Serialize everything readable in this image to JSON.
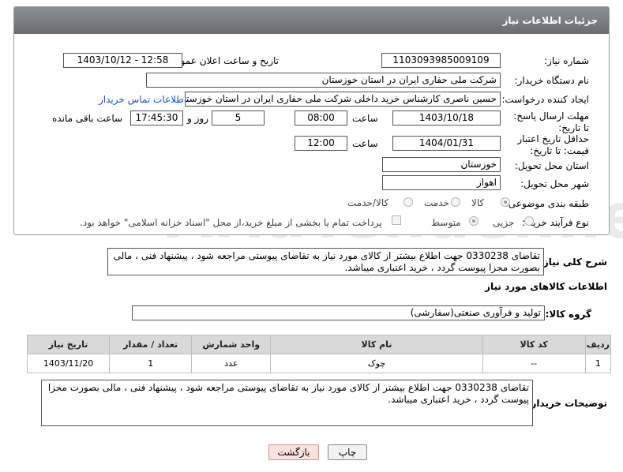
{
  "header": {
    "title": "جزئیات اطلاعات نیاز"
  },
  "fields": {
    "need_number_label": "شماره نیاز:",
    "need_number": "1103093985009109",
    "announce_label": "تاریخ و ساعت اعلان عمومی:",
    "announce_value": "1403/10/12 - 12:58",
    "buyer_org_label": "نام دستگاه خریدار:",
    "buyer_org": "شرکت ملی حفاری ایران در استان خوزستان",
    "requester_label": "ایجاد کننده درخواست:",
    "requester": "حسین ناصری کارشناس خرید داخلی شرکت ملی حفاری ایران در استان خوزستان",
    "contact_link": "اطلاعات تماس خریدار",
    "reply_deadline_label": "مهلت ارسال پاسخ: تا تاریخ:",
    "reply_date": "1403/10/18",
    "time_label": "ساعت",
    "reply_time": "08:00",
    "days_value": "5",
    "days_label": "روز و",
    "remaining_time": "17:45:30",
    "remaining_label": "ساعت باقی مانده",
    "price_validity_label": "حداقل تاریخ اعتبار قیمت: تا تاریخ:",
    "price_date": "1404/01/31",
    "price_time": "12:00",
    "province_label": "استان محل تحویل:",
    "province": "خوزستان",
    "city_label": "شهر محل تحویل:",
    "city": "اهواز",
    "category_label": "طبقه بندی موضوعی:",
    "cat_goods": "کالا",
    "cat_service": "خدمت",
    "cat_goods_service": "کالا/خدمت",
    "process_label": "نوع فرآیند خرید :",
    "proc_small": "جزیی",
    "proc_medium": "متوسط",
    "payment_note": "پرداخت تمام یا بخشی از مبلغ خرید،از محل \"اسناد خزانه اسلامی\" خواهد بود."
  },
  "description": {
    "label": "شرح کلی نیاز:",
    "text": "تقاضای 0330238 جهت اطلاع بیشتر از کالای مورد نیاز به تقاضای پیوستی مراجعه شود ، پیشنهاد فنی ، مالی بصورت مجزا پیوست گردد ، خرید اعتباری میباشد."
  },
  "goods": {
    "section_title": "اطلاعات کالاهای مورد نیاز",
    "group_label": "گروه کالا:",
    "group_value": "تولید و فرآوری صنعتی(سفارشی)",
    "columns": [
      "ردیف",
      "کد کالا",
      "نام کالا",
      "واحد شمارش",
      "تعداد / مقدار",
      "تاریخ نیاز"
    ],
    "rows": [
      [
        "1",
        "--",
        "چوک",
        "عدد",
        "1",
        "1403/11/20"
      ]
    ]
  },
  "buyer_notes": {
    "label": "توضیحات خریدار:",
    "text": "تقاضای 0330238 جهت اطلاع بیشتر از کالای مورد نیاز به تقاضای پیوستی مراجعه شود ، پیشنهاد فنی ، مالی بصورت مجزا پیوست گردد ، خرید اعتباری میباشد."
  },
  "buttons": {
    "print": "چاپ",
    "back": "بازگشت"
  },
  "watermark": "AriaTender.neT",
  "colors": {
    "header_bg": "#7a7e83",
    "link": "#1f4fd0",
    "back_button": "#fbe0e0"
  }
}
